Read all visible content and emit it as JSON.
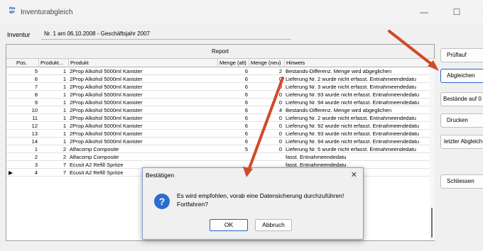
{
  "window": {
    "title": "Inventurabgleich",
    "icon_text": [
      "dsa",
      "MP"
    ],
    "controls": {
      "minimize": "—",
      "maximize": "☐",
      "close": "✕"
    }
  },
  "inventur": {
    "label": "Inventur",
    "value": "Nr. 1 am 06.10.2008 - Geschäftsjahr 2007"
  },
  "report": {
    "caption": "Report",
    "columns": [
      "Pos.",
      "Produkt...",
      "Produkt",
      "Menge (alt)",
      "Menge (neu)",
      "Hinweis"
    ],
    "rows": [
      {
        "marker": "",
        "pos": "5",
        "prod_id": "1",
        "product": "2Prop Alkohol 5000ml Kanister",
        "qty_old": "6",
        "qty_new": "2",
        "hint": "Bestands-Differenz. Menge wird abgeglichen"
      },
      {
        "marker": "",
        "pos": "6",
        "prod_id": "1",
        "product": "2Prop Alkohol 5000ml Kanister",
        "qty_old": "6",
        "qty_new": "0",
        "hint": "Lieferung Nr. 2 wurde nicht erfasst. Entnahmeendedatu"
      },
      {
        "marker": "",
        "pos": "7",
        "prod_id": "1",
        "product": "2Prop Alkohol 5000ml Kanister",
        "qty_old": "6",
        "qty_new": "0",
        "hint": "Lieferung Nr. 3 wurde nicht erfasst. Entnahmeendedatu"
      },
      {
        "marker": "",
        "pos": "8",
        "prod_id": "1",
        "product": "2Prop Alkohol 5000ml Kanister",
        "qty_old": "6",
        "qty_new": "0",
        "hint": "Lieferung Nr. 93 wurde nicht erfasst. Entnahmeendedatu"
      },
      {
        "marker": "",
        "pos": "9",
        "prod_id": "1",
        "product": "2Prop Alkohol 5000ml Kanister",
        "qty_old": "6",
        "qty_new": "0",
        "hint": "Lieferung Nr. 94 wurde nicht erfasst. Entnahmeendedatu"
      },
      {
        "marker": "",
        "pos": "10",
        "prod_id": "1",
        "product": "2Prop Alkohol 5000ml Kanister",
        "qty_old": "6",
        "qty_new": "4",
        "hint": "Bestands-Differenz. Menge wird abgeglichen"
      },
      {
        "marker": "",
        "pos": "11",
        "prod_id": "1",
        "product": "2Prop Alkohol 5000ml Kanister",
        "qty_old": "6",
        "qty_new": "0",
        "hint": "Lieferung Nr. 2 wurde nicht erfasst. Entnahmeendedatu"
      },
      {
        "marker": "",
        "pos": "12",
        "prod_id": "1",
        "product": "2Prop Alkohol 5000ml Kanister",
        "qty_old": "6",
        "qty_new": "0",
        "hint": "Lieferung Nr. 92 wurde nicht erfasst. Entnahmeendedatu"
      },
      {
        "marker": "",
        "pos": "13",
        "prod_id": "1",
        "product": "2Prop Alkohol 5000ml Kanister",
        "qty_old": "6",
        "qty_new": "0",
        "hint": "Lieferung Nr. 93 wurde nicht erfasst. Entnahmeendedatu"
      },
      {
        "marker": "",
        "pos": "14",
        "prod_id": "1",
        "product": "2Prop Alkohol 5000ml Kanister",
        "qty_old": "6",
        "qty_new": "0",
        "hint": "Lieferung Nr. 94 wurde nicht erfasst. Entnahmeendedatu"
      },
      {
        "marker": "",
        "pos": "1",
        "prod_id": "2",
        "product": "Alfacomp Composite",
        "qty_old": "5",
        "qty_new": "0",
        "hint": "Lieferung Nr. 5 wurde nicht erfasst. Entnahmeendedatu"
      },
      {
        "marker": "",
        "pos": "2",
        "prod_id": "2",
        "product": "Alfacomp Composite",
        "qty_old": "",
        "qty_new": "",
        "hint": "fasst. Entnahmeendedatu"
      },
      {
        "marker": "",
        "pos": "3",
        "prod_id": "7",
        "product": "Ecusit A2 Refill Spritze",
        "qty_old": "",
        "qty_new": "",
        "hint": "fasst. Entnahmeendedatu"
      },
      {
        "marker": "▶",
        "pos": "4",
        "prod_id": "7",
        "product": "Ecusit A2 Refill Spritze",
        "qty_old": "",
        "qty_new": "",
        "hint": "rfasst. Entnahmeendeda"
      }
    ]
  },
  "sidebar": {
    "pruflauf": "Prüflauf",
    "abgleichen": "Abgleichen",
    "bestaende": "Bestände auf 0",
    "drucken": "Drucken",
    "letzter": "letzter Abgleich",
    "schliessen": "Schliessen"
  },
  "dialog": {
    "title": "Bestätigen",
    "close": "✕",
    "icon": "?",
    "message_line1": "Es wird empfohlen, vorab eine Datensicherung durchzuführen!",
    "message_line2": "Fortfahren?",
    "ok_label": "OK",
    "abort_label": "Abbruch"
  },
  "colors": {
    "accent": "#2a62c8",
    "annotation_arrow": "#d04a2a"
  }
}
